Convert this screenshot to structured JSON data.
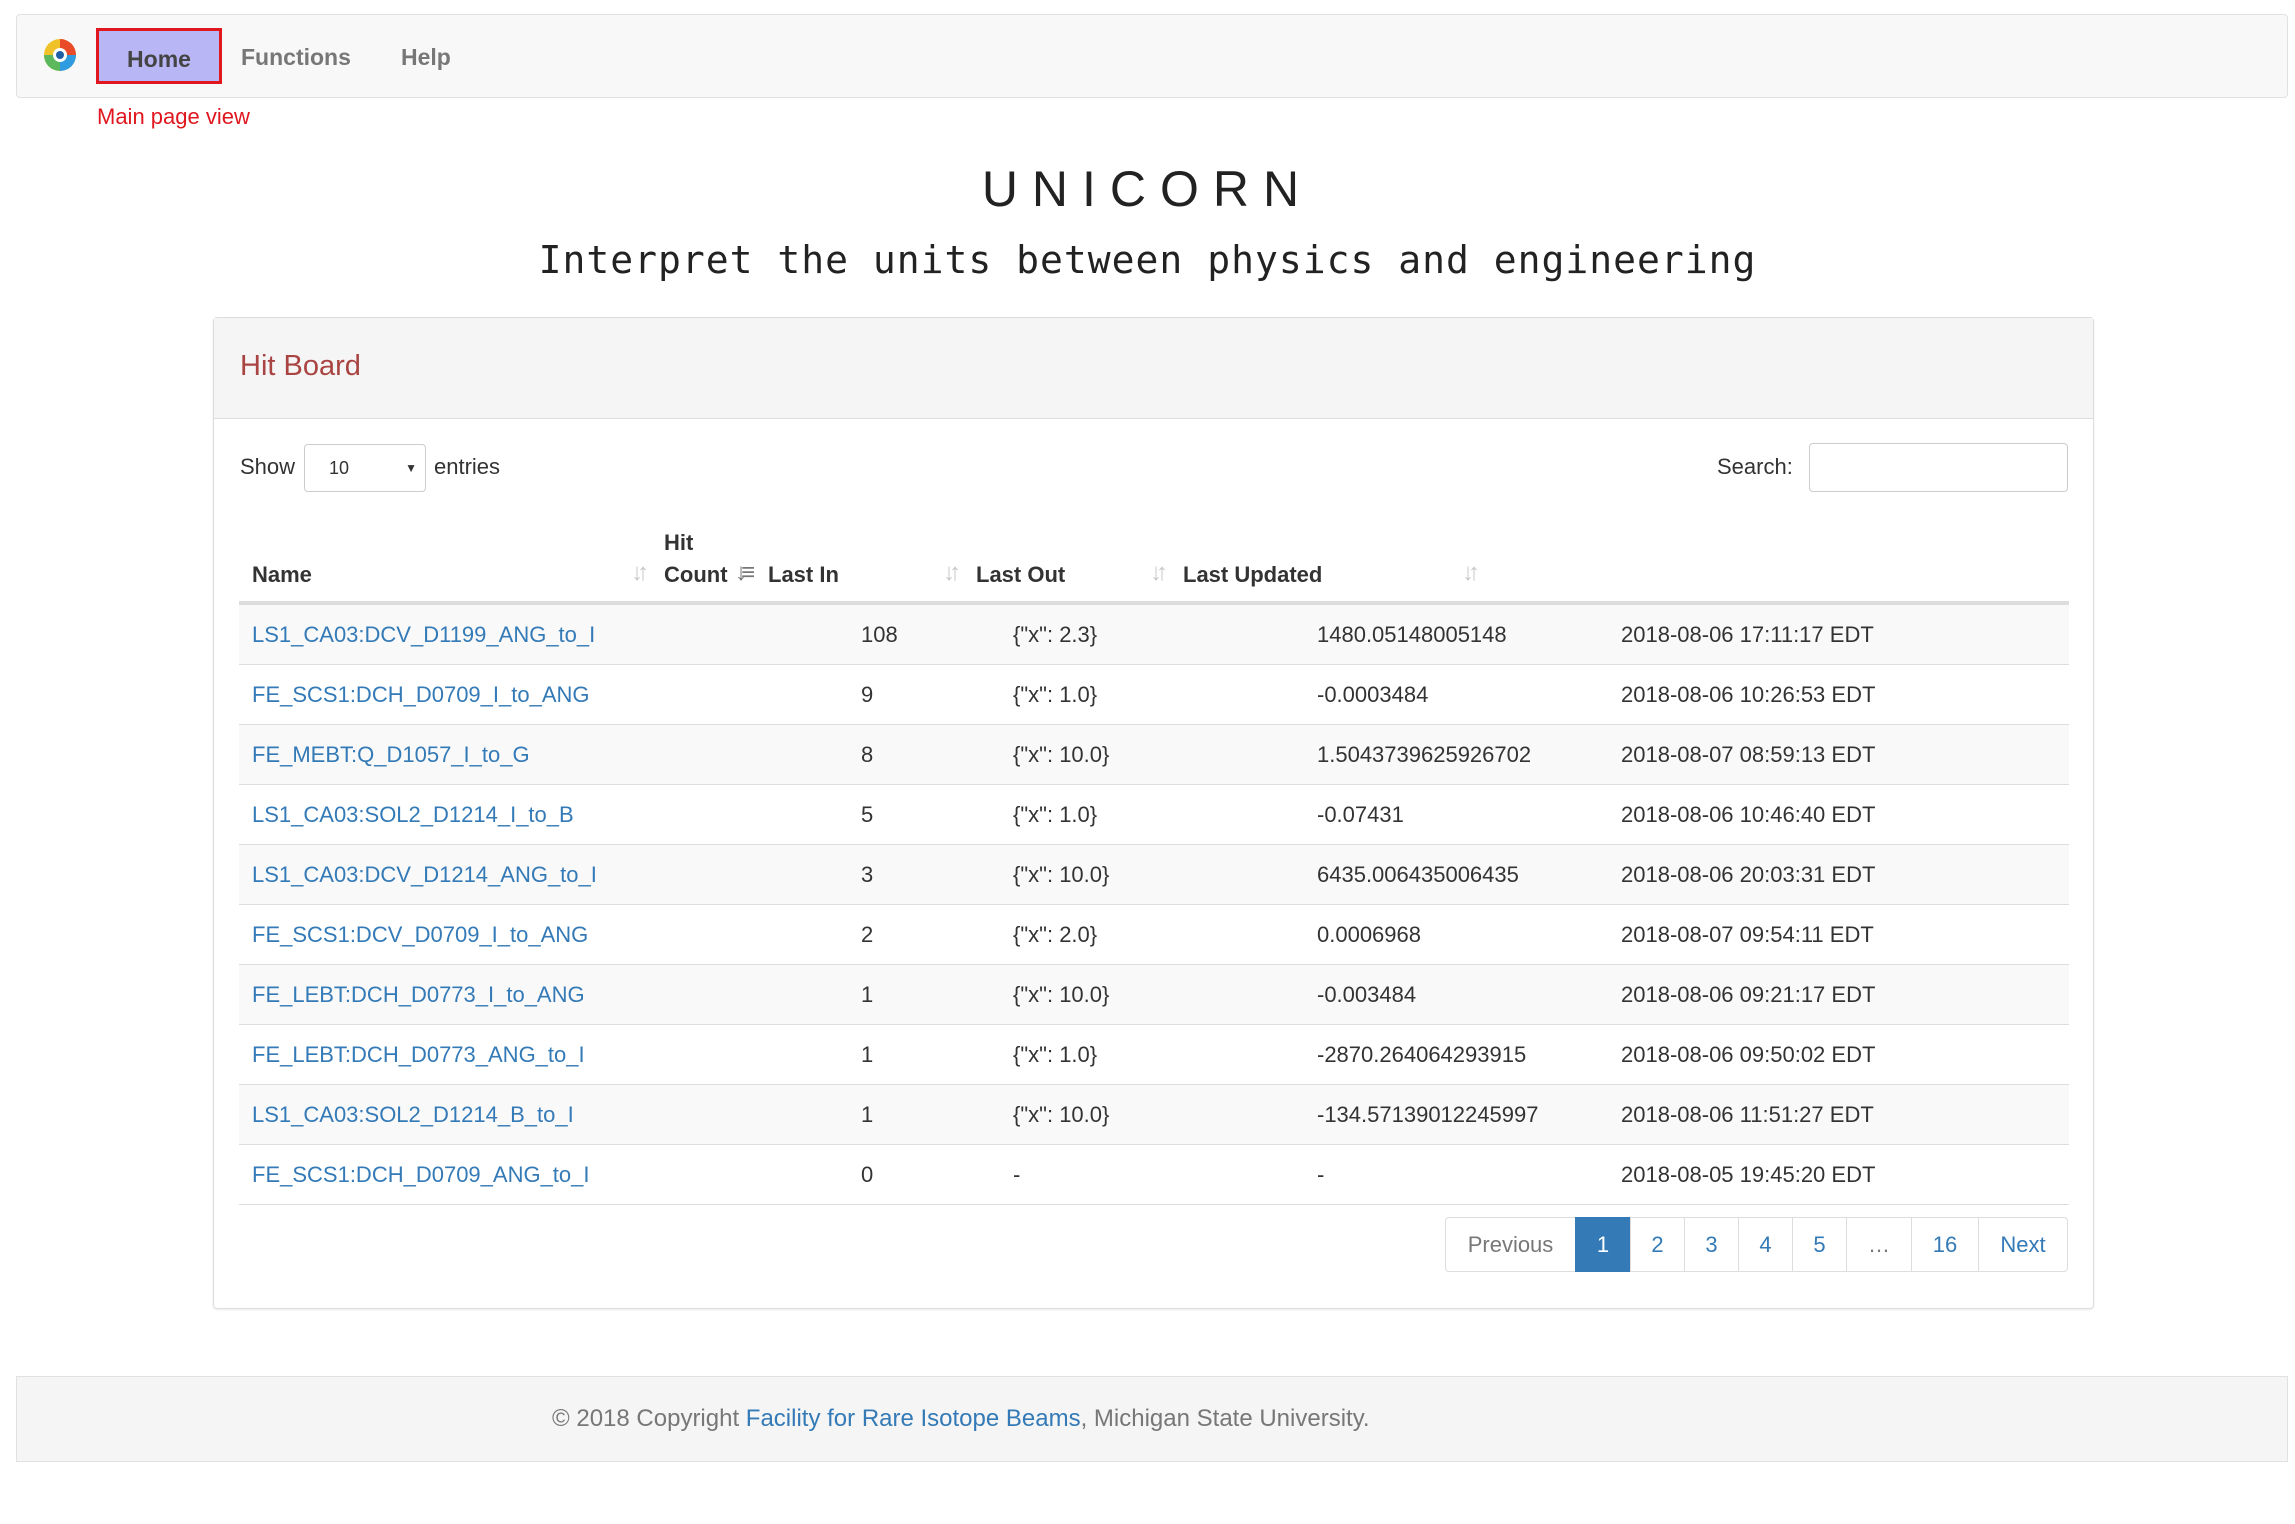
{
  "nav": {
    "items": [
      {
        "label": "Home"
      },
      {
        "label": "Functions"
      },
      {
        "label": "Help"
      }
    ]
  },
  "annotation": "Main page view",
  "header": {
    "title": "UNICORN",
    "subtitle": "Interpret the units between physics and engineering"
  },
  "panel": {
    "title": "Hit Board",
    "show_label": "Show",
    "entries_value": "10",
    "entries_label": "entries",
    "search_label": "Search:",
    "search_value": ""
  },
  "table": {
    "columns": [
      "Name",
      "Hit Count",
      "Last In",
      "Last Out",
      "Last Updated"
    ],
    "rows": [
      {
        "name": "LS1_CA03:DCV_D1199_ANG_to_I",
        "hit": "108",
        "last_in": "{\"x\": 2.3}",
        "last_out": "1480.05148005148",
        "updated": "2018-08-06 17:11:17 EDT"
      },
      {
        "name": "FE_SCS1:DCH_D0709_I_to_ANG",
        "hit": "9",
        "last_in": "{\"x\": 1.0}",
        "last_out": "-0.0003484",
        "updated": "2018-08-06 10:26:53 EDT"
      },
      {
        "name": "FE_MEBT:Q_D1057_I_to_G",
        "hit": "8",
        "last_in": "{\"x\": 10.0}",
        "last_out": "1.5043739625926702",
        "updated": "2018-08-07 08:59:13 EDT"
      },
      {
        "name": "LS1_CA03:SOL2_D1214_I_to_B",
        "hit": "5",
        "last_in": "{\"x\": 1.0}",
        "last_out": "-0.07431",
        "updated": "2018-08-06 10:46:40 EDT"
      },
      {
        "name": "LS1_CA03:DCV_D1214_ANG_to_I",
        "hit": "3",
        "last_in": "{\"x\": 10.0}",
        "last_out": "6435.006435006435",
        "updated": "2018-08-06 20:03:31 EDT"
      },
      {
        "name": "FE_SCS1:DCV_D0709_I_to_ANG",
        "hit": "2",
        "last_in": "{\"x\": 2.0}",
        "last_out": "0.0006968",
        "updated": "2018-08-07 09:54:11 EDT"
      },
      {
        "name": "FE_LEBT:DCH_D0773_I_to_ANG",
        "hit": "1",
        "last_in": "{\"x\": 10.0}",
        "last_out": "-0.003484",
        "updated": "2018-08-06 09:21:17 EDT"
      },
      {
        "name": "FE_LEBT:DCH_D0773_ANG_to_I",
        "hit": "1",
        "last_in": "{\"x\": 1.0}",
        "last_out": "-2870.264064293915",
        "updated": "2018-08-06 09:50:02 EDT"
      },
      {
        "name": "LS1_CA03:SOL2_D1214_B_to_I",
        "hit": "1",
        "last_in": "{\"x\": 10.0}",
        "last_out": "-134.57139012245997",
        "updated": "2018-08-06 11:51:27 EDT"
      },
      {
        "name": "FE_SCS1:DCH_D0709_ANG_to_I",
        "hit": "0",
        "last_in": "-",
        "last_out": "-",
        "updated": "2018-08-05 19:45:20 EDT"
      }
    ]
  },
  "pagination": {
    "previous": "Previous",
    "pages": [
      "1",
      "2",
      "3",
      "4",
      "5",
      "…",
      "16"
    ],
    "next": "Next",
    "active_page": "1"
  },
  "footer": {
    "prefix": "© 2018 Copyright ",
    "link": "Facility for Rare Isotope Beams",
    "suffix": ", Michigan State University."
  },
  "colors": {
    "accent": "#337ab7",
    "highlight": "#b9b6f5",
    "annotation": "#e0171f",
    "panel_title": "#a94442"
  }
}
